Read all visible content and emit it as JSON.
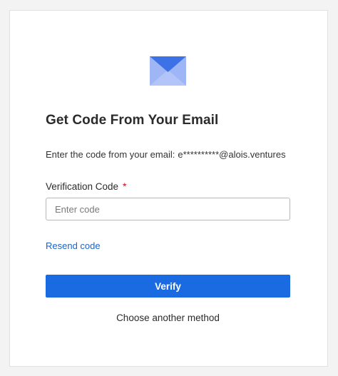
{
  "icon": "mail-envelope-icon",
  "colors": {
    "accent": "#1a6ae2",
    "link": "#1a63c7",
    "required": "#d0021b",
    "icon_light": "#9eb5f6",
    "icon_dark": "#3d72e6"
  },
  "title": "Get Code From Your Email",
  "instructions": {
    "prefix": "Enter the code from your email:",
    "email": "e**********@alois.ventures"
  },
  "field": {
    "label": "Verification Code",
    "required_mark": "*",
    "placeholder": "Enter code",
    "value": ""
  },
  "resend_label": "Resend code",
  "verify_label": "Verify",
  "another_method_label": "Choose another method"
}
